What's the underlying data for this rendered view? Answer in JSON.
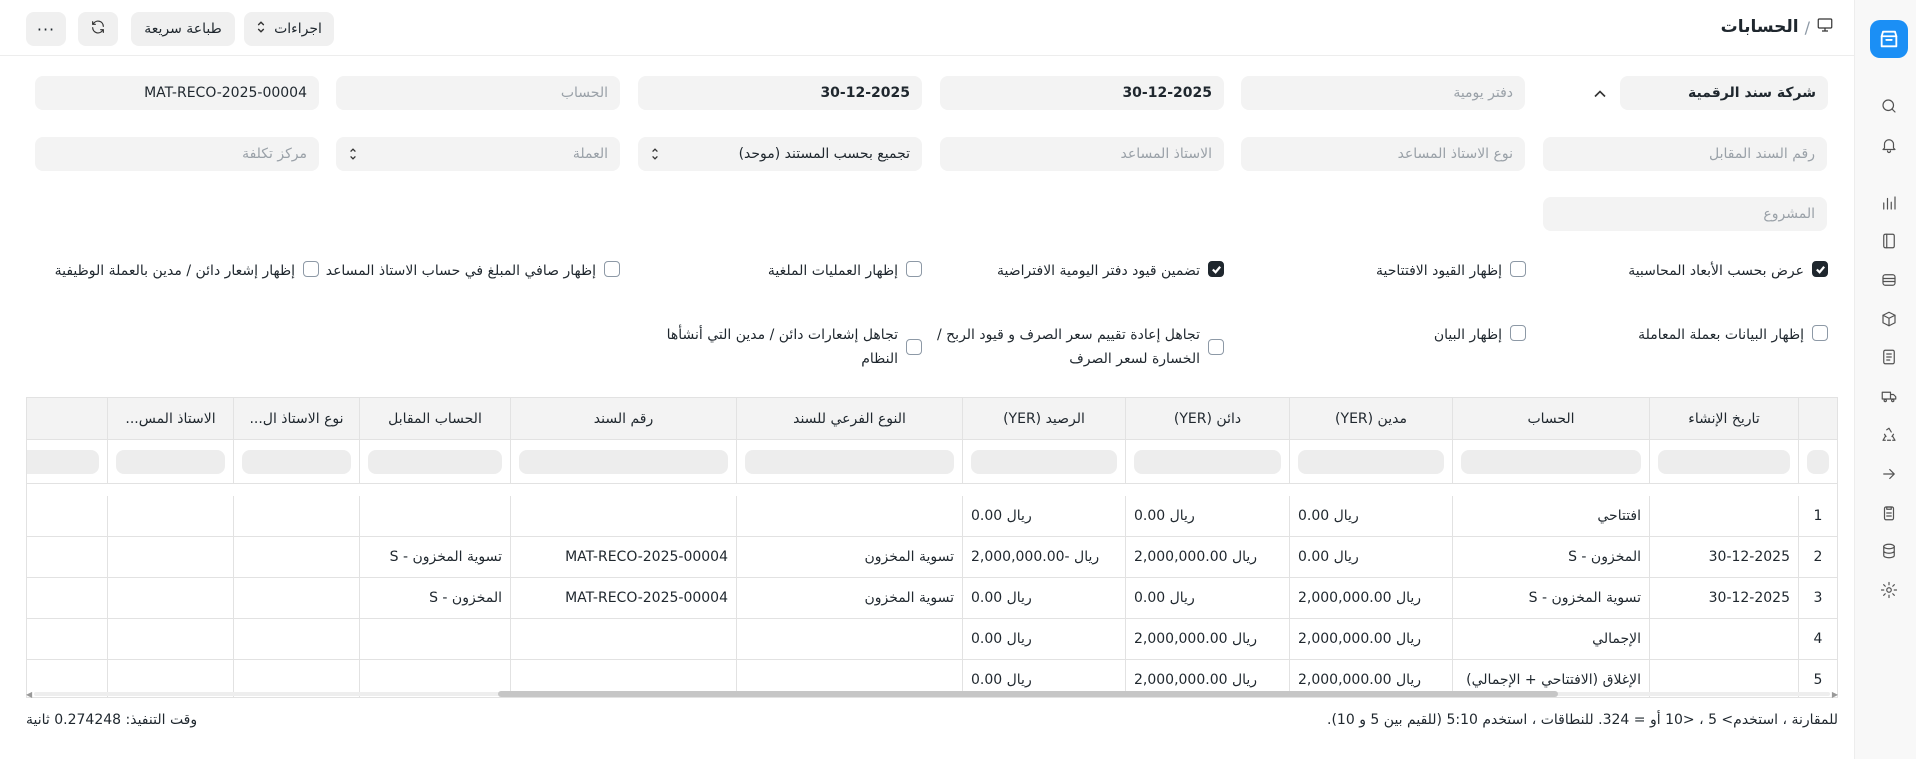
{
  "header": {
    "title": "الحسابات",
    "breadcrumb_sep": "/",
    "actions_label": "اجراءات",
    "quick_print_label": "طباعة سريعة"
  },
  "filters": {
    "company": "شركة سند الرقمية",
    "journal_placeholder": "دفتر يومية",
    "from_date": "30-12-2025",
    "to_date": "30-12-2025",
    "account_placeholder": "الحساب",
    "voucher_no": "MAT-RECO-2025-00004",
    "against_voucher_placeholder": "رقم السند المقابل",
    "party_type_placeholder": "نوع الاستاذ المساعد",
    "party_placeholder": "الاستاذ المساعد",
    "group_by": "تجميع بحسب المستند (موحد)",
    "currency_placeholder": "العملة",
    "cost_center_placeholder": "مركز تكلفة",
    "project_placeholder": "المشروع"
  },
  "checkboxes": {
    "c1": {
      "label": "عرض بحسب الأبعاد المحاسبية",
      "checked": true
    },
    "c2": {
      "label": "إظهار القيود الافتتاحية",
      "checked": false
    },
    "c3": {
      "label": "تضمين قيود دفتر اليومية الافتراضية",
      "checked": true
    },
    "c4": {
      "label": "إظهار العمليات الملغية",
      "checked": false
    },
    "c5": {
      "label": "إظهار صافي المبلغ في حساب الاستاذ المساعد",
      "checked": false
    },
    "c6": {
      "label": "إظهار إشعار دائن / مدين بالعملة الوظيفية",
      "checked": false
    },
    "c7": {
      "label": "إظهار البيانات بعملة المعاملة",
      "checked": false
    },
    "c8": {
      "label": "إظهار البيان",
      "checked": false
    },
    "c9": {
      "label_line1": "تجاهل إعادة تقييم سعر الصرف و قيود الربح /",
      "label_line2": "الخسارة لسعر الصرف",
      "checked": false
    },
    "c10": {
      "label_line1": "تجاهل إشعارات دائن / مدين التي أنشأها",
      "label_line2": "النظام",
      "checked": false
    }
  },
  "table": {
    "columns": [
      "تاريخ الإنشاء",
      "الحساب",
      "مدين (YER)",
      "دائن (YER)",
      "الرصيد (YER)",
      "النوع الفرعي للسند",
      "رقم السند",
      "الحساب المقابل",
      "نوع الاستاذ ال...",
      "الاستاذ المس..."
    ],
    "rows": [
      {
        "no": "1",
        "date": "",
        "account": "افتتاحي",
        "debit": "ريال 0.00",
        "credit": "ريال 0.00",
        "balance": "ريال 0.00",
        "subtype": "",
        "voucher": "",
        "against": "",
        "party_type": "",
        "party": ""
      },
      {
        "no": "2",
        "date": "30-12-2025",
        "account": "المخزون - S",
        "debit": "ريال 0.00",
        "credit": "ريال 2,000,000.00",
        "balance": "ريال -2,000,000.00",
        "subtype": "تسوية المخزون",
        "voucher": "MAT-RECO-2025-00004",
        "against": "تسوية المخزون - S",
        "party_type": "",
        "party": ""
      },
      {
        "no": "3",
        "date": "30-12-2025",
        "account": "تسوية المخزون - S",
        "debit": "ريال 2,000,000.00",
        "credit": "ريال 0.00",
        "balance": "ريال 0.00",
        "subtype": "تسوية المخزون",
        "voucher": "MAT-RECO-2025-00004",
        "against": "المخزون - S",
        "party_type": "",
        "party": ""
      },
      {
        "no": "4",
        "date": "",
        "account": "الإجمالي",
        "debit": "ريال 2,000,000.00",
        "credit": "ريال 2,000,000.00",
        "balance": "ريال 0.00",
        "subtype": "",
        "voucher": "",
        "against": "",
        "party_type": "",
        "party": ""
      },
      {
        "no": "5",
        "date": "",
        "account": "الإغلاق (الافتتاحي + الإجمالي)",
        "debit": "ريال 2,000,000.00",
        "credit": "ريال 2,000,000.00",
        "balance": "ريال 0.00",
        "subtype": "",
        "voucher": "",
        "against": "",
        "party_type": "",
        "party": ""
      }
    ]
  },
  "footer": {
    "hint": "للمقارنة ، استخدم> 5 ، <10 أو = 324. للنطاقات ، استخدم 5:10 (للقيم بين 5 و 10).",
    "exec_time": "وقت التنفيذ: 0.274248 ثانية"
  },
  "icons": {
    "sidebar": [
      "app-logo-icon",
      "search-icon",
      "bell-icon",
      "chart-icon",
      "book-icon",
      "bank-icon",
      "box-icon",
      "document-icon",
      "truck-icon",
      "recycle-icon",
      "arrow-right-icon",
      "clipboard-icon",
      "database-icon",
      "gear-icon"
    ],
    "header": [
      "desktop-icon",
      "refresh-icon",
      "more-icon",
      "sort-arrows-icon"
    ]
  },
  "colors": {
    "accent": "#1b8ff5",
    "field_bg": "#f3f3f3",
    "checked": "#1f272e"
  }
}
